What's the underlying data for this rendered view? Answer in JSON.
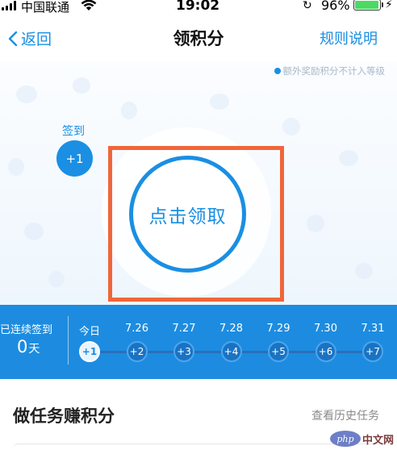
{
  "status_bar": {
    "carrier": "中国联通",
    "time": "19:02",
    "battery_percent": "96%",
    "battery_level": 0.96,
    "signal_icon": "signal-bars-icon",
    "wifi_icon": "wifi-icon",
    "lock_icon": "orientation-lock-icon",
    "charging_icon": "bolt-icon"
  },
  "nav": {
    "back_label": "返回",
    "title": "领积分",
    "rules_label": "规则说明",
    "back_icon": "chevron-left-icon"
  },
  "hero": {
    "note": "额外奖励积分不计入等级",
    "checkin_label": "签到",
    "checkin_badge": "+1",
    "claim_label": "点击领取"
  },
  "streak": {
    "label": "已连续签到",
    "count": "0",
    "unit": "天",
    "days": [
      {
        "date": "今日",
        "points": "+1",
        "today": true
      },
      {
        "date": "7.26",
        "points": "+2",
        "today": false
      },
      {
        "date": "7.27",
        "points": "+3",
        "today": false
      },
      {
        "date": "7.28",
        "points": "+4",
        "today": false
      },
      {
        "date": "7.29",
        "points": "+5",
        "today": false
      },
      {
        "date": "7.30",
        "points": "+6",
        "today": false
      },
      {
        "date": "7.31",
        "points": "+7",
        "today": false
      }
    ]
  },
  "tasks": {
    "title": "做任务赚积分",
    "history_label": "查看历史任务"
  },
  "watermark": {
    "logo": "php",
    "text": "中文网"
  },
  "colors": {
    "accent": "#1a8fe3",
    "highlight": "#f0663a",
    "streak_bg": "#1d8ce0"
  }
}
